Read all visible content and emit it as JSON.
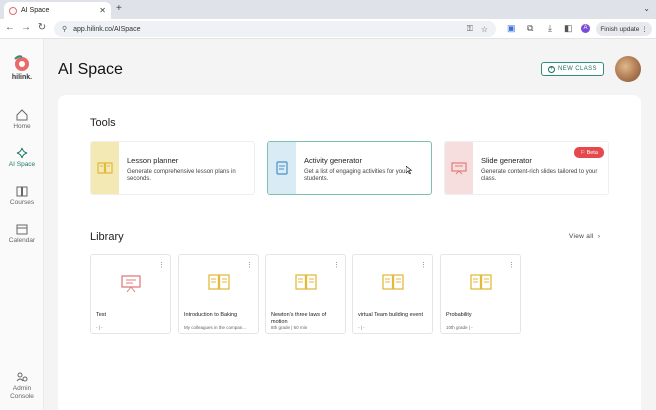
{
  "browser": {
    "tab_title": "AI Space",
    "url": "app.hilink.co/AISpace",
    "finish_update": "Finish update",
    "profile_letter": "A"
  },
  "sidebar": {
    "logo_text": "hilink.",
    "items": [
      {
        "label": "Home"
      },
      {
        "label": "AI Space"
      },
      {
        "label": "Courses"
      },
      {
        "label": "Calendar"
      },
      {
        "label": "Admin Console"
      }
    ]
  },
  "header": {
    "title": "AI Space",
    "new_class_label": "NEW CLASS"
  },
  "tools": {
    "heading": "Tools",
    "items": [
      {
        "name": "Lesson planner",
        "desc": "Generate comprehensive lesson plans in seconds.",
        "accent": "#f3e9b5"
      },
      {
        "name": "Activity generator",
        "desc": "Get a list of engaging activities for your students.",
        "accent": "#d9ecf6"
      },
      {
        "name": "Slide generator",
        "desc": "Generate content-rich slides tailored to your class.",
        "accent": "#f7dede",
        "badge": "Beta"
      }
    ]
  },
  "library": {
    "heading": "Library",
    "view_all": "View all",
    "items": [
      {
        "name": "Test",
        "meta": "- | -",
        "icon": "presentation-icon"
      },
      {
        "name": "Introduction to Baking",
        "meta": "My colleagues in the compan...",
        "icon": "book-icon"
      },
      {
        "name": "Newton's three laws of motion",
        "meta": "8th grade | 60 min",
        "icon": "book-icon"
      },
      {
        "name": "virtual Team building event",
        "meta": "- | -",
        "icon": "book-icon"
      },
      {
        "name": "Probability",
        "meta": "10th grade | -",
        "icon": "book-icon"
      }
    ]
  },
  "colors": {
    "brand": "#2f8f7d",
    "beta": "#e5484d",
    "icon_yellow": "#e3b93b",
    "icon_red": "#e27c7c",
    "icon_blue": "#4a8ec2"
  }
}
